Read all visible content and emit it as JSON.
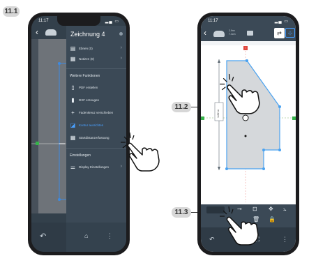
{
  "steps": {
    "step1": "11.1",
    "step2": "11.2",
    "step3": "11.3"
  },
  "phone1": {
    "status_time": "11:17",
    "menu_title": "Zeichnung 4",
    "items_top": [
      {
        "label": "Ebnen (0)",
        "icon": "layers-icon"
      },
      {
        "label": "Notizen (0)",
        "icon": "notes-icon"
      }
    ],
    "section_functions": "Weitere Funktionen",
    "items_functions": [
      {
        "label": "PDF erstellen",
        "icon": "pdf-icon"
      },
      {
        "label": "DXF erzeugen",
        "icon": "dxf-icon"
      },
      {
        "label": "Fadenkreuz verschieben",
        "icon": "crosshair-icon"
      },
      {
        "label": "Kontur ausrichten",
        "icon": "align-contour-icon"
      },
      {
        "label": "Startdistanzerfassung",
        "icon": "grid-icon"
      }
    ],
    "section_settings": "Einstellungen",
    "items_settings": [
      {
        "label": "Display Einstellungen",
        "icon": "sliders-icon"
      }
    ]
  },
  "phone2": {
    "status_time": "11:17",
    "info_line1": "2.9m²",
    "info_line2": "7.4cm",
    "dimension_label": "1.82 m",
    "marker_label": "!"
  },
  "colors": {
    "accent_blue": "#49a0ff",
    "panel_dark": "#3b4956",
    "marker_red": "#e0453c",
    "marker_green": "#36b24a",
    "shape_fill": "#d5d8db"
  }
}
